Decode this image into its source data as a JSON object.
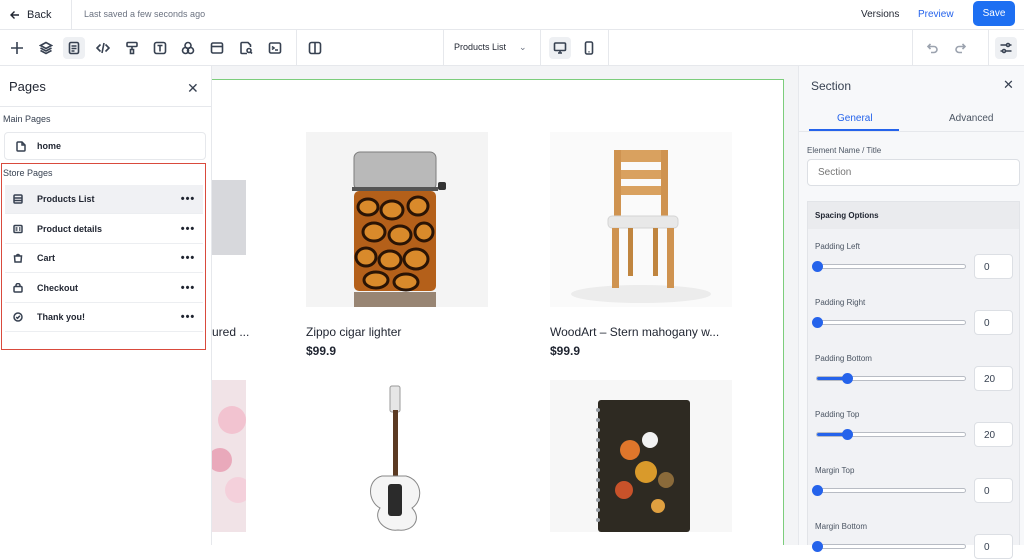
{
  "topbar": {
    "back_label": "Back",
    "saved_status": "Last saved a few seconds ago",
    "versions_label": "Versions",
    "preview_label": "Preview",
    "save_label": "Save"
  },
  "toolbar": {
    "page_select": "Products List",
    "icons": [
      "plus-icon",
      "layers-icon",
      "pages-icon",
      "code-icon",
      "paint-roller-icon",
      "text-icon",
      "shapes-icon",
      "browser-icon",
      "page-search-icon",
      "terminal-icon",
      "split-view-icon",
      "desktop-icon",
      "mobile-icon",
      "undo-icon",
      "redo-icon",
      "settings-sliders-icon"
    ]
  },
  "pages_panel": {
    "title": "Pages",
    "main_label": "Main Pages",
    "home": "home",
    "store_label": "Store Pages",
    "store_items": [
      {
        "label": "Products List",
        "icon": "product-list-icon",
        "selected": true
      },
      {
        "label": "Product details",
        "icon": "product-details-icon",
        "selected": false
      },
      {
        "label": "Cart",
        "icon": "cart-icon",
        "selected": false
      },
      {
        "label": "Checkout",
        "icon": "checkout-icon",
        "selected": false
      },
      {
        "label": "Thank you!",
        "icon": "check-circle-icon",
        "selected": false
      }
    ],
    "more_label": "•••"
  },
  "products": [
    {
      "name": "ured ...",
      "price": ""
    },
    {
      "name": "Zippo cigar lighter",
      "price": "$99.9"
    },
    {
      "name": "WoodArt – Stern mahogany w...",
      "price": "$99.9"
    }
  ],
  "properties": {
    "title": "Section",
    "tabs": [
      "General",
      "Advanced"
    ],
    "element_name_label": "Element Name / Title",
    "element_name_placeholder": "Section",
    "spacing_title": "Spacing Options",
    "sliders": [
      {
        "label": "Padding Left",
        "value": "0",
        "fraction": 0.0
      },
      {
        "label": "Padding Right",
        "value": "0",
        "fraction": 0.0
      },
      {
        "label": "Padding Bottom",
        "value": "20",
        "fraction": 0.2
      },
      {
        "label": "Padding Top",
        "value": "20",
        "fraction": 0.2
      },
      {
        "label": "Margin Top",
        "value": "0",
        "fraction": 0.0
      },
      {
        "label": "Margin Bottom",
        "value": "0",
        "fraction": 0.0
      }
    ]
  },
  "colors": {
    "accent": "#1d6ff2",
    "highlight_border": "#d94a3c",
    "canvas_outline": "#7ccd7c"
  }
}
